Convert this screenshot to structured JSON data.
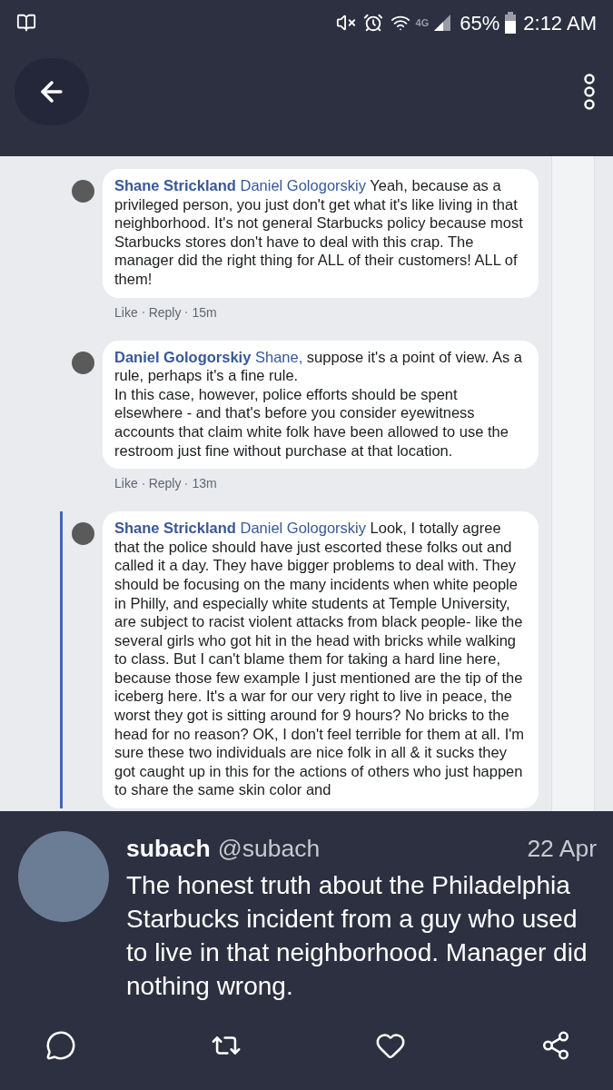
{
  "status_bar": {
    "network": "4G",
    "battery": "65%",
    "time": "2:12 AM"
  },
  "comments": [
    {
      "author": "Shane Strickland",
      "mention": "Daniel Gologorskiy",
      "text": "Yeah, because as a privileged person, you just don't get what it's like living in that neighborhood. It's not general Starbucks policy because most Starbucks stores don't have to deal with this crap. The manager did the right thing for ALL of their customers! ALL of them!",
      "like": "Like",
      "reply": "Reply",
      "time": "15m",
      "highlighted": false
    },
    {
      "author": "Daniel Gologorskiy",
      "mention": "Shane,",
      "text": "suppose it's a point of view. As a rule, perhaps it's a fine rule.\nIn this case, however, police efforts should be spent elsewhere - and that's before you consider eyewitness accounts that claim white folk have been allowed to use the restroom just fine without purchase at that location.",
      "like": "Like",
      "reply": "Reply",
      "time": "13m",
      "highlighted": false
    },
    {
      "author": "Shane Strickland",
      "mention": "Daniel Gologorskiy",
      "text": "Look, I totally agree that the police should have just escorted these folks out and called it a day. They have bigger problems to deal with. They should be focusing on the many incidents when white people in Philly, and especially white students at Temple University, are subject to racist violent attacks from black people- like the several girls who got hit in the head with bricks while walking to class. But I can't blame them for taking a hard line here, because those few example I just mentioned are the tip of the iceberg here. It's a war for our very right to live in peace, the worst they got is sitting around for 9 hours? No bricks to the head for no reason? OK, I don't feel terrible for them at all. I'm sure these two individuals are nice folk in all & it sucks they got caught up in this for the actions of others who just happen to share the same skin color and",
      "highlighted": true
    }
  ],
  "tweet": {
    "name": "subach",
    "handle": "@subach",
    "date": "22 Apr",
    "text": "The honest truth about the Philadelphia Starbucks incident from a guy who used to live in that neighborhood. Manager did nothing wrong."
  }
}
